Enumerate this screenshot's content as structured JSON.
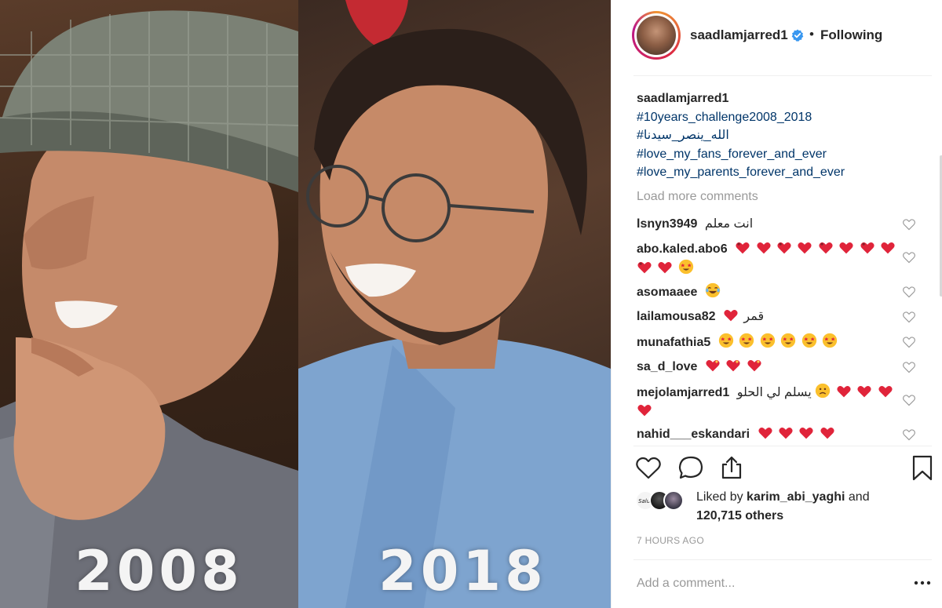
{
  "media": {
    "left_year": "2008",
    "right_year": "2018"
  },
  "header": {
    "username": "saadlamjarred1",
    "separator": "•",
    "follow_status": "Following"
  },
  "caption": {
    "username": "saadlamjarred1",
    "hashtags": [
      "#10years_challenge2008_2018",
      "#الله_ينصر_سيدنا",
      "#love_my_fans_forever_and_ever",
      "#love_my_parents_forever_and_ever"
    ]
  },
  "load_more": "Load more comments",
  "comments": [
    {
      "user": "lsnyn3949",
      "text": "انت معلم"
    },
    {
      "user": "abo.kaled.abo6",
      "text": ""
    },
    {
      "user": "asomaaee",
      "text": ""
    },
    {
      "user": "lailamousa82",
      "text": "قمر"
    },
    {
      "user": "munafathia5",
      "text": ""
    },
    {
      "user": "sa_d_love",
      "text": ""
    },
    {
      "user": "mejolamjarred1",
      "text": "يسلم لي الحلو"
    },
    {
      "user": "nahid___eskandari",
      "text": ""
    }
  ],
  "likes": {
    "prefix": "Liked by",
    "user": "karim_abi_yaghi",
    "conjunction": "and",
    "others": "120,715 others"
  },
  "timestamp": "7 HOURS AGO",
  "add_comment": {
    "placeholder": "Add a comment..."
  },
  "icons": {
    "like": "heart-outline-icon",
    "comment": "speech-bubble-icon",
    "share": "share-upload-icon",
    "save": "bookmark-icon",
    "verified": "verified-badge-icon",
    "more": "more-options-icon"
  },
  "colors": {
    "link": "#003569",
    "verified": "#3897f0",
    "muted": "#999999",
    "heart_emoji": "#e0243a"
  }
}
